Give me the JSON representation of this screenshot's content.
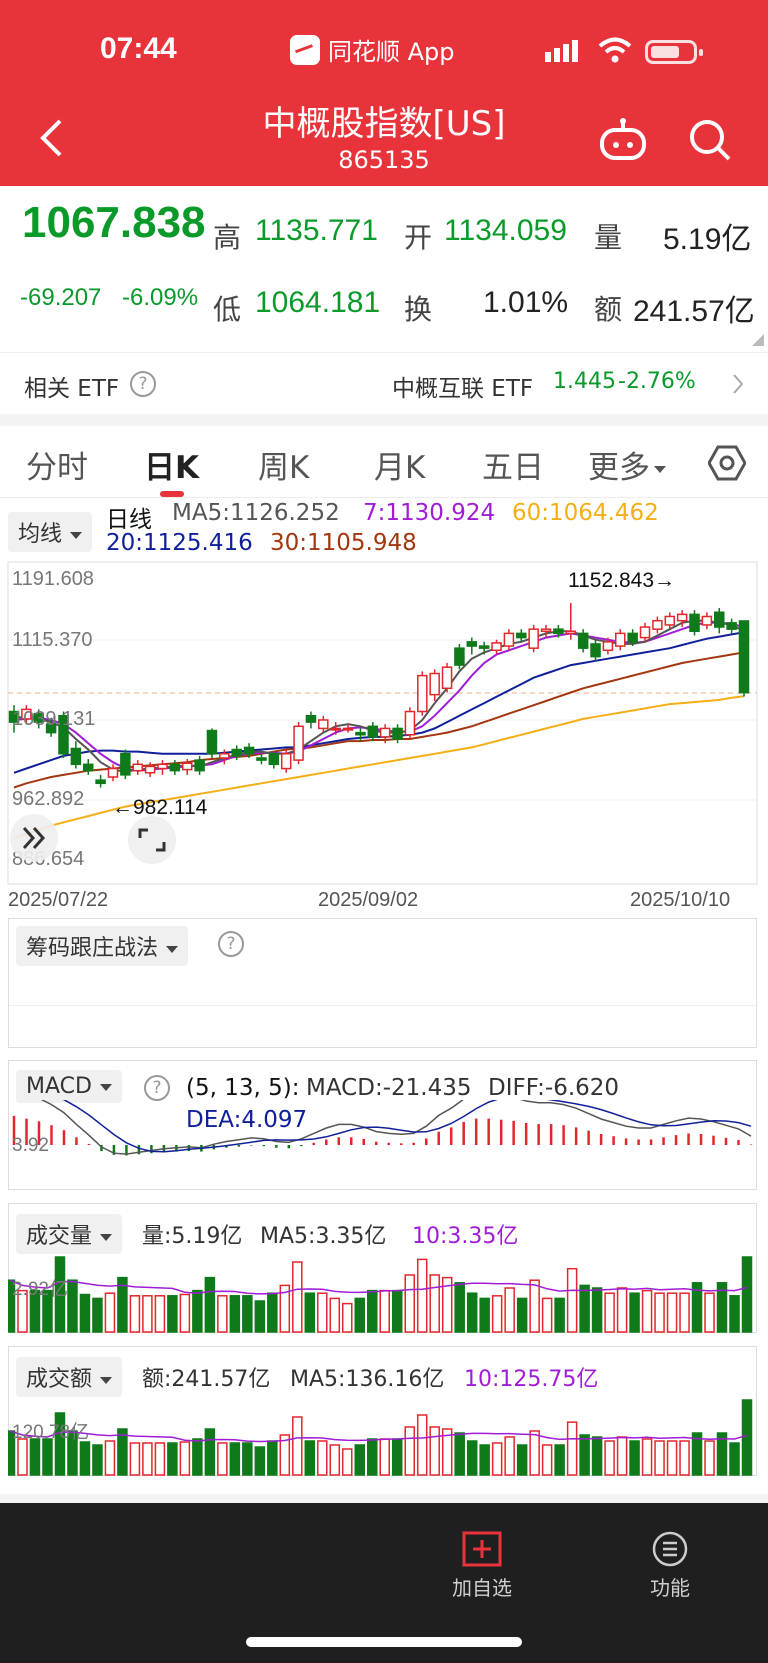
{
  "status": {
    "time": "07:44",
    "app_name": "同花顺 App"
  },
  "header": {
    "title": "中概股指数[US]",
    "code": "865135"
  },
  "quote": {
    "price": "1067.838",
    "change": "-69.207",
    "change_pct": "-6.09%",
    "high_label": "高",
    "high": "1135.771",
    "open_label": "开",
    "open": "1134.059",
    "volume_label": "量",
    "volume": "5.19亿",
    "low_label": "低",
    "low": "1064.181",
    "turnover_label": "换",
    "turnover": "1.01%",
    "amount_label": "额",
    "amount": "241.57亿"
  },
  "etf": {
    "label": "相关 ETF",
    "name": "中概互联 ETF",
    "price": "1.445",
    "pct": "-2.76%"
  },
  "tabs": [
    "分时",
    "日K",
    "周K",
    "月K",
    "五日",
    "更多"
  ],
  "ma_legend": {
    "chip": "均线",
    "title": "日线",
    "ma5": "MA5:1126.252",
    "ma7": "7:1130.924",
    "ma60": "60:1064.462",
    "ma20": "20:1125.416",
    "ma30": "30:1105.948"
  },
  "colors": {
    "up": "#e3262b",
    "down": "#0f7a1a",
    "ma5": "#555555",
    "ma7": "#a01cd6",
    "ma20": "#10209a",
    "ma30": "#a3360e",
    "ma60": "#f6ae16"
  },
  "kline": {
    "y_ticks": [
      "1191.608",
      "1115.370",
      "1039.131",
      "962.892",
      "886.654"
    ],
    "max_label": "1152.843→",
    "min_label": "←982.114",
    "dates": [
      "2025/07/22",
      "2025/09/02",
      "2025/10/10"
    ]
  },
  "chips_panel": {
    "chip": "筹码跟庄战法"
  },
  "macd": {
    "chip": "MACD",
    "params": "(5, 13, 5):",
    "macd": "MACD:-21.435",
    "diff": "DIFF:-6.620",
    "dea": "DEA:4.097",
    "axis": "3.92"
  },
  "volume": {
    "chip": "成交量",
    "v": "量:5.19亿",
    "ma5": "MA5:3.35亿",
    "ma10": "10:3.35亿",
    "axis": "2.92亿"
  },
  "amount": {
    "chip": "成交额",
    "v": "额:241.57亿",
    "ma5": "MA5:136.16亿",
    "ma10": "10:125.75亿",
    "axis": "120.78亿"
  },
  "bottom": {
    "add": "加自选",
    "func": "功能"
  },
  "chart_data": {
    "type": "candlestick",
    "title": "日线",
    "x_start": "2025/07/22",
    "x_mid": "2025/09/02",
    "x_end": "2025/10/10",
    "ylim": [
      886.654,
      1191.608
    ],
    "candles": [
      {
        "o": 1050,
        "c": 1040,
        "h": 1056,
        "l": 1030
      },
      {
        "o": 1043,
        "c": 1052,
        "h": 1056,
        "l": 1038
      },
      {
        "o": 1048,
        "c": 1040,
        "h": 1052,
        "l": 1034
      },
      {
        "o": 1038,
        "c": 1030,
        "h": 1044,
        "l": 1026
      },
      {
        "o": 1046,
        "c": 1010,
        "h": 1050,
        "l": 1006
      },
      {
        "o": 1015,
        "c": 1000,
        "h": 1022,
        "l": 996
      },
      {
        "o": 1000,
        "c": 994,
        "h": 1005,
        "l": 990
      },
      {
        "o": 985,
        "c": 982,
        "h": 990,
        "l": 978
      },
      {
        "o": 988,
        "c": 996,
        "h": 1000,
        "l": 984
      },
      {
        "o": 1010,
        "c": 990,
        "h": 1014,
        "l": 986
      },
      {
        "o": 994,
        "c": 1000,
        "h": 1004,
        "l": 990
      },
      {
        "o": 992,
        "c": 998,
        "h": 1002,
        "l": 988
      },
      {
        "o": 996,
        "c": 1000,
        "h": 1004,
        "l": 990
      },
      {
        "o": 1000,
        "c": 994,
        "h": 1004,
        "l": 990
      },
      {
        "o": 995,
        "c": 1001,
        "h": 1005,
        "l": 990
      },
      {
        "o": 1004,
        "c": 994,
        "h": 1008,
        "l": 990
      },
      {
        "o": 1032,
        "c": 1010,
        "h": 1034,
        "l": 1006
      },
      {
        "o": 1006,
        "c": 1010,
        "h": 1014,
        "l": 1000
      },
      {
        "o": 1014,
        "c": 1008,
        "h": 1018,
        "l": 1004
      },
      {
        "o": 1016,
        "c": 1010,
        "h": 1020,
        "l": 1006
      },
      {
        "o": 1006,
        "c": 1004,
        "h": 1010,
        "l": 1000
      },
      {
        "o": 1010,
        "c": 1000,
        "h": 1012,
        "l": 996
      },
      {
        "o": 996,
        "c": 1010,
        "h": 1014,
        "l": 992
      },
      {
        "o": 1004,
        "c": 1036,
        "h": 1040,
        "l": 1000
      },
      {
        "o": 1046,
        "c": 1040,
        "h": 1050,
        "l": 1034
      },
      {
        "o": 1034,
        "c": 1042,
        "h": 1046,
        "l": 1030
      },
      {
        "o": 1034,
        "c": 1034,
        "h": 1040,
        "l": 1028
      },
      {
        "o": 1034,
        "c": 1034,
        "h": 1038,
        "l": 1030
      },
      {
        "o": 1030,
        "c": 1028,
        "h": 1034,
        "l": 1022
      },
      {
        "o": 1036,
        "c": 1026,
        "h": 1040,
        "l": 1022
      },
      {
        "o": 1026,
        "c": 1034,
        "h": 1038,
        "l": 1020
      },
      {
        "o": 1034,
        "c": 1024,
        "h": 1038,
        "l": 1020
      },
      {
        "o": 1028,
        "c": 1050,
        "h": 1054,
        "l": 1024
      },
      {
        "o": 1050,
        "c": 1084,
        "h": 1088,
        "l": 1046
      },
      {
        "o": 1066,
        "c": 1086,
        "h": 1090,
        "l": 1060
      },
      {
        "o": 1072,
        "c": 1092,
        "h": 1096,
        "l": 1068
      },
      {
        "o": 1110,
        "c": 1094,
        "h": 1114,
        "l": 1090
      },
      {
        "o": 1116,
        "c": 1112,
        "h": 1120,
        "l": 1104
      },
      {
        "o": 1112,
        "c": 1110,
        "h": 1116,
        "l": 1104
      },
      {
        "o": 1108,
        "c": 1115,
        "h": 1118,
        "l": 1104
      },
      {
        "o": 1112,
        "c": 1124,
        "h": 1128,
        "l": 1108
      },
      {
        "o": 1124,
        "c": 1120,
        "h": 1128,
        "l": 1116
      },
      {
        "o": 1110,
        "c": 1128,
        "h": 1132,
        "l": 1106
      },
      {
        "o": 1126,
        "c": 1128,
        "h": 1132,
        "l": 1120
      },
      {
        "o": 1128,
        "c": 1124,
        "h": 1132,
        "l": 1120
      },
      {
        "o": 1124,
        "c": 1126,
        "h": 1152.843,
        "l": 1118
      },
      {
        "o": 1124,
        "c": 1110,
        "h": 1128,
        "l": 1106
      },
      {
        "o": 1114,
        "c": 1102,
        "h": 1118,
        "l": 1098
      },
      {
        "o": 1108,
        "c": 1116,
        "h": 1120,
        "l": 1104
      },
      {
        "o": 1112,
        "c": 1124,
        "h": 1128,
        "l": 1108
      },
      {
        "o": 1124,
        "c": 1116,
        "h": 1128,
        "l": 1112
      },
      {
        "o": 1120,
        "c": 1130,
        "h": 1134,
        "l": 1116
      },
      {
        "o": 1128,
        "c": 1136,
        "h": 1140,
        "l": 1124
      },
      {
        "o": 1132,
        "c": 1140,
        "h": 1144,
        "l": 1128
      },
      {
        "o": 1136,
        "c": 1142,
        "h": 1146,
        "l": 1130
      },
      {
        "o": 1142,
        "c": 1126,
        "h": 1146,
        "l": 1122
      },
      {
        "o": 1132,
        "c": 1140,
        "h": 1144,
        "l": 1128
      },
      {
        "o": 1144,
        "c": 1130,
        "h": 1148,
        "l": 1124
      },
      {
        "o": 1134,
        "c": 1128,
        "h": 1138,
        "l": 1124
      },
      {
        "o": 1135.771,
        "c": 1067.838,
        "h": 1135.771,
        "l": 1064.181
      }
    ],
    "ma5": [
      1045,
      1044,
      1043,
      1040,
      1035,
      1024,
      1014,
      1002,
      995,
      993,
      995,
      996,
      997,
      998,
      999,
      998,
      1002,
      1006,
      1009,
      1012,
      1012,
      1010,
      1010,
      1014,
      1022,
      1030,
      1036,
      1038,
      1036,
      1032,
      1030,
      1030,
      1032,
      1042,
      1058,
      1072,
      1088,
      1100,
      1106,
      1110,
      1114,
      1116,
      1120,
      1124,
      1126,
      1126,
      1122,
      1118,
      1116,
      1114,
      1114,
      1116,
      1122,
      1128,
      1134,
      1136,
      1136,
      1134,
      1132,
      1126
    ],
    "ma7": [
      1042,
      1043,
      1044,
      1042,
      1038,
      1030,
      1020,
      1010,
      1002,
      996,
      994,
      995,
      996,
      997,
      998,
      999,
      1000,
      1004,
      1008,
      1010,
      1011,
      1011,
      1010,
      1012,
      1018,
      1024,
      1030,
      1034,
      1035,
      1034,
      1032,
      1031,
      1031,
      1036,
      1046,
      1058,
      1070,
      1084,
      1096,
      1104,
      1108,
      1112,
      1116,
      1120,
      1122,
      1124,
      1122,
      1120,
      1118,
      1116,
      1115,
      1116,
      1120,
      1124,
      1128,
      1132,
      1134,
      1134,
      1133,
      1130
    ],
    "ma20": [
      992,
      996,
      1000,
      1004,
      1008,
      1010,
      1012,
      1013,
      1013,
      1012,
      1012,
      1011,
      1010,
      1010,
      1010,
      1010,
      1010,
      1011,
      1012,
      1013,
      1014,
      1015,
      1016,
      1016,
      1018,
      1020,
      1022,
      1024,
      1025,
      1026,
      1026,
      1027,
      1028,
      1030,
      1034,
      1040,
      1046,
      1052,
      1058,
      1064,
      1070,
      1076,
      1082,
      1086,
      1090,
      1094,
      1096,
      1098,
      1100,
      1102,
      1104,
      1106,
      1108,
      1110,
      1113,
      1116,
      1119,
      1121,
      1123,
      1125
    ],
    "ma30": [
      978,
      982,
      985,
      988,
      990,
      992,
      994,
      995,
      996,
      997,
      998,
      999,
      1000,
      1001,
      1002,
      1004,
      1005,
      1006,
      1007,
      1008,
      1010,
      1012,
      1014,
      1015,
      1016,
      1018,
      1020,
      1022,
      1022,
      1023,
      1023,
      1024,
      1024,
      1026,
      1028,
      1030,
      1033,
      1036,
      1040,
      1044,
      1048,
      1052,
      1056,
      1060,
      1064,
      1068,
      1072,
      1075,
      1078,
      1081,
      1084,
      1087,
      1090,
      1093,
      1096,
      1098,
      1100,
      1102,
      1104,
      1106
    ],
    "ma60": [
      930,
      934,
      938,
      942,
      945,
      948,
      951,
      954,
      957,
      960,
      962,
      964,
      966,
      968,
      970,
      972,
      974,
      976,
      978,
      980,
      982,
      984,
      986,
      988,
      990,
      992,
      994,
      996,
      998,
      1000,
      1002,
      1004,
      1006,
      1008,
      1010,
      1012,
      1014,
      1016,
      1019,
      1022,
      1025,
      1028,
      1031,
      1034,
      1037,
      1040,
      1043,
      1045,
      1047,
      1049,
      1051,
      1053,
      1055,
      1057,
      1058,
      1059,
      1060,
      1061,
      1063,
      1064.462
    ]
  }
}
